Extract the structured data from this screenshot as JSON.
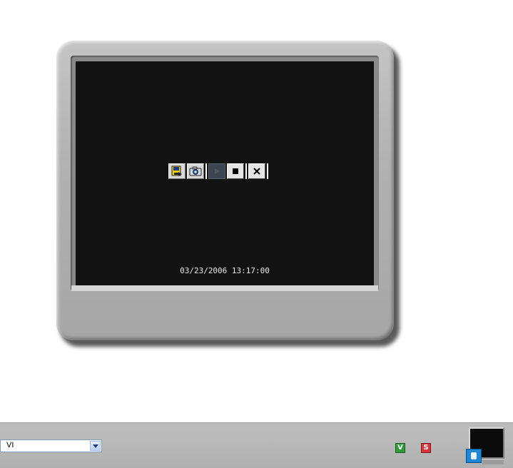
{
  "viewer": {
    "timestamp": "03/23/2006 13:17:00",
    "toolbar": {
      "buttons": [
        {
          "icon": "save-snapshot-icon"
        },
        {
          "icon": "camera-icon"
        },
        {
          "icon": "play-icon",
          "state": "disabled"
        },
        {
          "icon": "stop-icon"
        },
        {
          "icon": "close-icon"
        }
      ]
    }
  },
  "bottom_bar": {
    "channel_select": {
      "value": "VI",
      "options_visible": false
    },
    "green_button_label": "V",
    "red_button_label": "S",
    "colors": {
      "green": "#2f9a3a",
      "red": "#d8323a",
      "blue": "#1e88d8"
    }
  }
}
